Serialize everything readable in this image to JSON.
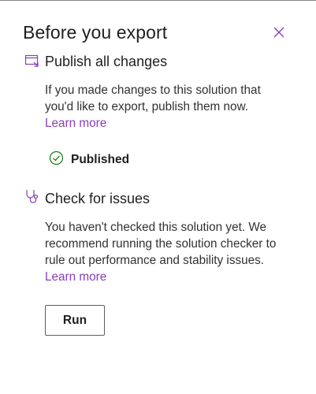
{
  "panel": {
    "title": "Before you export"
  },
  "publish": {
    "title": "Publish all changes",
    "description": "If you made changes to this solution that you'd like to export, publish them now.",
    "link": "Learn more",
    "status": "Published"
  },
  "check": {
    "title": "Check for issues",
    "description": "You haven't checked this solution yet. We recommend running the solution checker to rule out performance and stability issues.",
    "link": "Learn more",
    "run_label": "Run"
  },
  "colors": {
    "link": "#8a3fb5",
    "success": "#107c10",
    "text": "#201f1e"
  }
}
